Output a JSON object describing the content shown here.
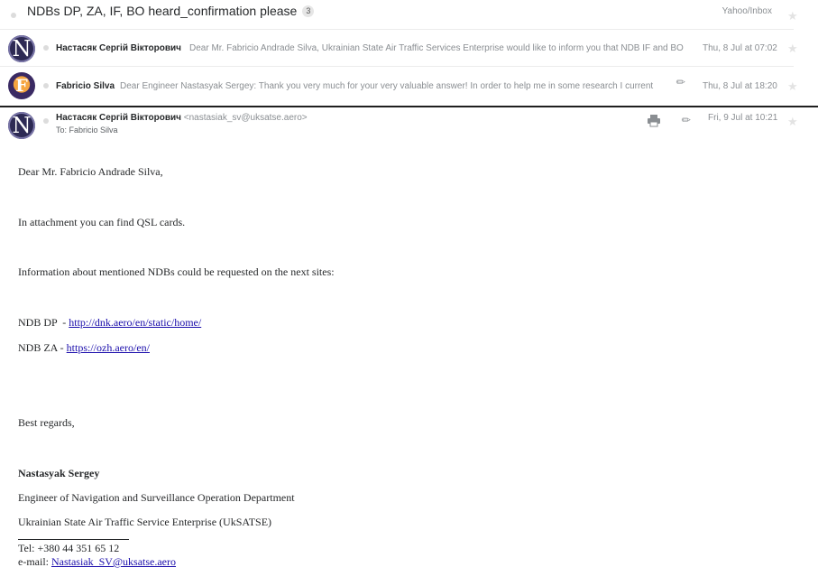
{
  "thread": {
    "subject": "NDBs DP, ZA, IF, BO heard_confirmation please",
    "count": "3",
    "folder": "Yahoo/Inbox"
  },
  "messages": [
    {
      "sender": "Настасяк Сергій Вікторович",
      "snippet": "Dear Mr. Fabricio Andrade Silva, Ukrainian State Air Traffic Services Enterprise would like to inform you that NDB IF and BO",
      "date": "Thu, 8 Jul at 07:02",
      "avatar_letter": "N",
      "avatar_icon": "nastasyak-avatar"
    },
    {
      "sender": "Fabricio Silva",
      "snippet": "Dear Engineer Nastasyak Sergey: Thank you very much for your very valuable answer! In order to help me in some research I current",
      "date": "Thu, 8 Jul at 18:20",
      "avatar_letter": "F",
      "avatar_icon": "fabricio-avatar",
      "has_attachment": true
    }
  ],
  "open_message": {
    "sender": "Настасяк Сергій Вікторович",
    "email": "<nastasiak_sv@uksatse.aero>",
    "to": "To: Fabricio Silva",
    "date": "Fri, 9 Jul at 10:21",
    "avatar_letter": "N",
    "body": {
      "greeting": "Dear Mr. Fabricio Andrade Silva,",
      "line1": "In attachment you can find QSL cards.",
      "line2": "Information about mentioned NDBs could be requested on the next sites:",
      "ndb_dp_label": "NDB DP  - ",
      "ndb_dp_link": "http://dnk.aero/en/static/home/",
      "ndb_za_label": "NDB ZA - ",
      "ndb_za_link": "https://ozh.aero/en/",
      "regards": "Best regards,",
      "sig_name": "Nastasyak Sergey",
      "sig_title": "Engineer of Navigation and Surveillance Operation Department",
      "sig_org": "Ukrainian State Air Traffic Service Enterprise (UkSATSE)",
      "tel": "Tel: +380 44 351 65 12",
      "email_label": "e-mail: ",
      "email_link": "Nastasiak_SV@uksatse.aero"
    }
  },
  "icons": {
    "star": "☆",
    "print": "printer-icon",
    "attachment": "paperclip-icon"
  },
  "colors": {
    "link": "#1a0dab",
    "muted": "#8a8e92",
    "text": "#26282a"
  }
}
